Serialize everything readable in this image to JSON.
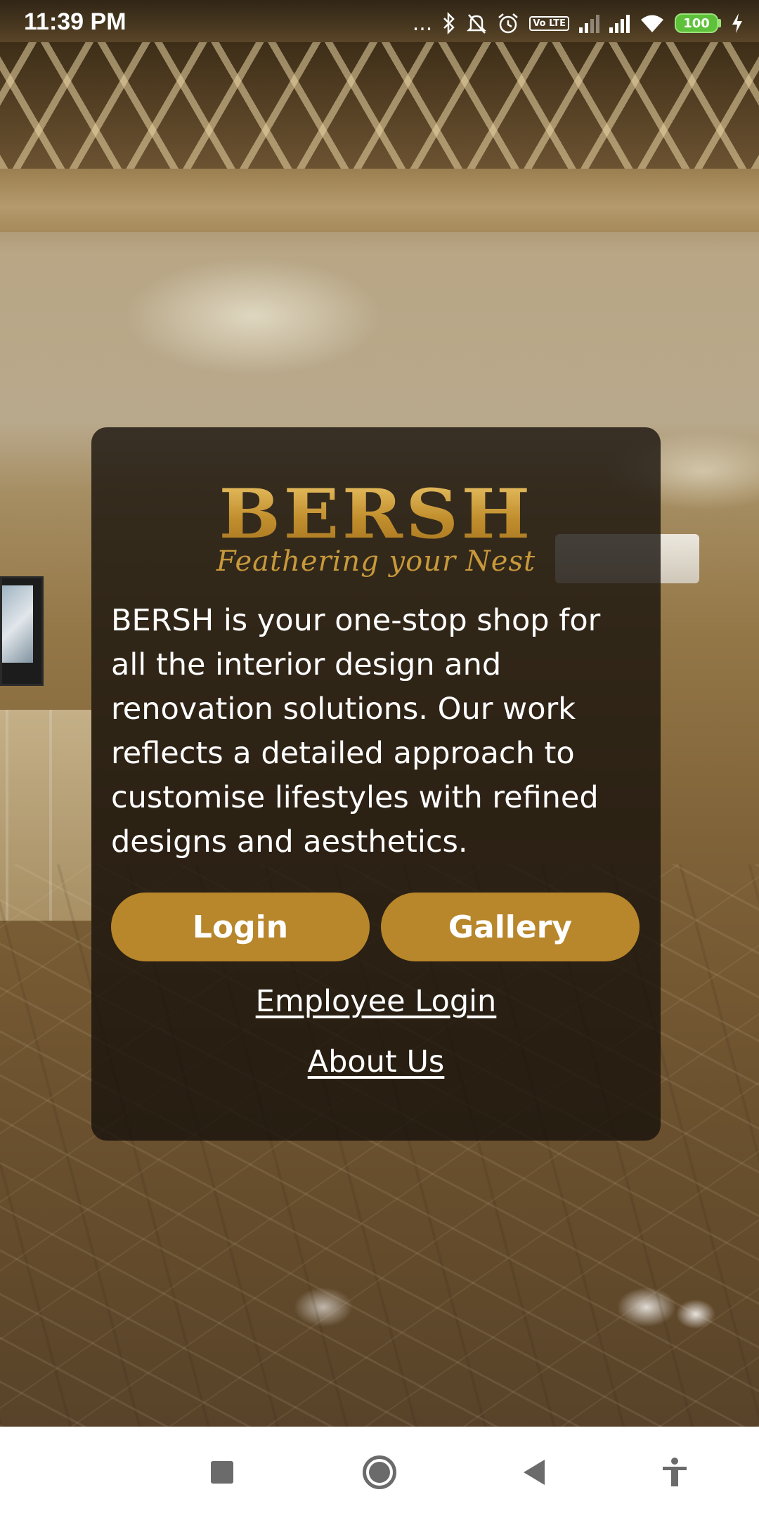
{
  "status_bar": {
    "time": "11:39 PM",
    "more_dots": "...",
    "volte": "Vo LTE",
    "battery_level": "100",
    "icons": [
      "more-notifications-icon",
      "bluetooth-icon",
      "silent-bell-icon",
      "alarm-icon",
      "volte-icon",
      "signal-icon",
      "signal-icon",
      "wifi-icon",
      "battery-icon",
      "charging-icon"
    ]
  },
  "card": {
    "logo_text": "BERSH",
    "tagline": "Feathering your Nest",
    "description": "BERSH is your one-stop shop for all the interior design and renovation solutions. Our work reflects a detailed approach to customise lifestyles with refined designs and aesthetics.",
    "login_label": "Login",
    "gallery_label": "Gallery",
    "employee_login_label": "Employee Login",
    "about_us_label": "About Us"
  },
  "nav_bar": {
    "icons": [
      "recents-icon",
      "home-icon",
      "back-icon",
      "accessibility-icon"
    ]
  },
  "colors": {
    "accent": "#b8862b",
    "logo_gold": "#c8993b",
    "card_background": "rgba(20,16,10,0.78)"
  }
}
